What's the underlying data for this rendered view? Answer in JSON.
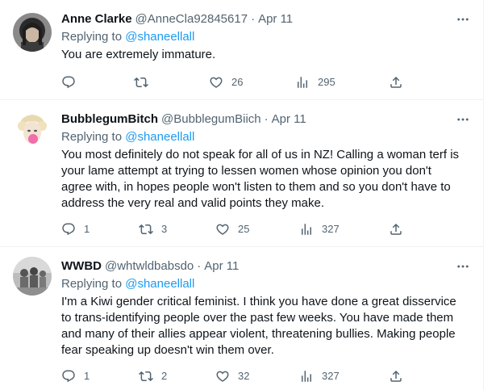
{
  "tweets": [
    {
      "name": "Anne Clarke",
      "handle": "@AnneCla92845617",
      "separator": "·",
      "date": "Apr 11",
      "reply_prefix": "Replying to",
      "reply_to": "@shaneellall",
      "text": "You are extremely immature.",
      "replies": "",
      "retweets": "",
      "likes": "26",
      "views": "295",
      "avatar_icon": "avatar-dark-hair"
    },
    {
      "name": "BubblegumBitch",
      "handle": "@BubblegumBiich",
      "separator": "·",
      "date": "Apr 11",
      "reply_prefix": "Replying to",
      "reply_to": "@shaneellall",
      "text": "You most definitely do not speak for all of us in NZ! Calling a woman terf is\nyour lame attempt at trying to lessen women whose opinion you don't\nagree with, in hopes people won't listen to them and so you don't have to\naddress the very real and valid points they make.",
      "replies": "1",
      "retweets": "3",
      "likes": "25",
      "views": "327",
      "avatar_icon": "avatar-blonde-bubblegum"
    },
    {
      "name": "WWBD",
      "handle": "@whtwldbabsdo",
      "separator": "·",
      "date": "Apr 11",
      "reply_prefix": "Replying to",
      "reply_to": "@shaneellall",
      "text": "I'm a Kiwi gender critical feminist. I think you have done a great disservice\nto trans-identifying people over the past few weeks. You have made them\nand many of their allies appear violent, threatening bullies. Making people\nfear speaking up doesn't win them over.",
      "replies": "1",
      "retweets": "2",
      "likes": "32",
      "views": "327",
      "avatar_icon": "avatar-group-photo"
    }
  ],
  "colors": {
    "text": "#0f1419",
    "secondary": "#536471",
    "link": "#1d9bf0",
    "border": "#eff3f4"
  }
}
